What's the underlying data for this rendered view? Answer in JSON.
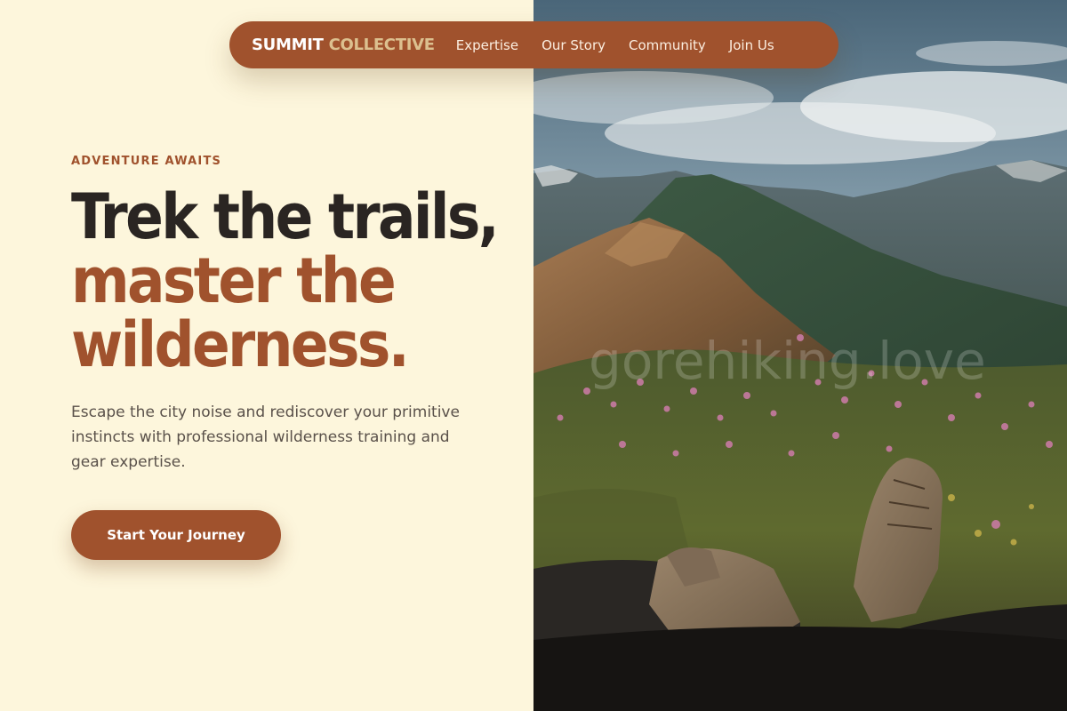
{
  "nav": {
    "brand_primary": "SUMMIT",
    "brand_secondary": "COLLECTIVE",
    "links": [
      "Expertise",
      "Our Story",
      "Community",
      "Join Us"
    ]
  },
  "hero": {
    "eyebrow": "ADVENTURE AWAITS",
    "headline_line1": "Trek the trails,",
    "headline_line2": "master the",
    "headline_line3": "wilderness.",
    "description": "Escape the city noise and rediscover your primitive instincts with professional wilderness training and gear expertise.",
    "cta_label": "Start Your Journey"
  },
  "watermark": "gorehiking.love",
  "colors": {
    "background": "#fdf6dc",
    "accent": "#a0522d",
    "brand_secondary": "#dcc08f",
    "headline_dark": "#2a2522",
    "body_text": "#5a514a"
  }
}
